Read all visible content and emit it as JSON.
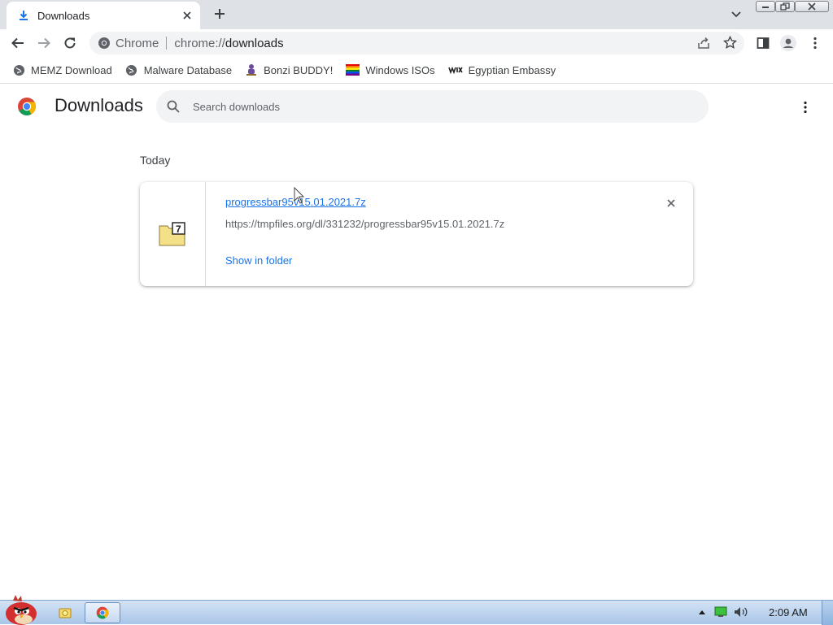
{
  "tab": {
    "title": "Downloads"
  },
  "omnibox": {
    "chip": "Chrome",
    "scheme": "chrome://",
    "path": "downloads"
  },
  "bookmarks": [
    {
      "label": "MEMZ Download",
      "icon": "globe-icon"
    },
    {
      "label": "Malware Database",
      "icon": "globe-icon"
    },
    {
      "label": "Bonzi BUDDY!",
      "icon": "bonzi-icon"
    },
    {
      "label": "Windows ISOs",
      "icon": "rainbow-icon"
    },
    {
      "label": "Egyptian Embassy",
      "icon": "wix-icon"
    }
  ],
  "page": {
    "title": "Downloads",
    "search_placeholder": "Search downloads",
    "date_header": "Today"
  },
  "download": {
    "file_name": "progressbar95v15.01.2021.7z",
    "url": "https://tmpfiles.org/dl/331232/progressbar95v15.01.2021.7z",
    "action": "Show in folder",
    "file_icon": "7z-archive-icon"
  },
  "taskbar": {
    "clock": "2:09 AM"
  },
  "colors": {
    "link": "#1a73e8",
    "tabstrip": "#dee1e6",
    "omnibox": "#f1f3f4"
  }
}
